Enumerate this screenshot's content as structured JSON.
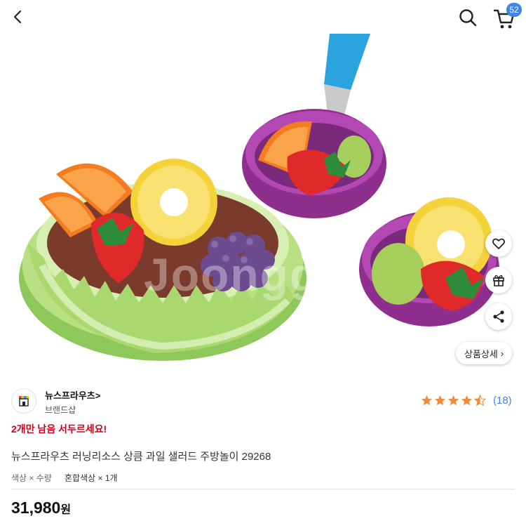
{
  "header": {
    "back_icon": "chevron-left-icon",
    "search_icon": "search-icon",
    "cart_icon": "cart-icon",
    "cart_count": "52",
    "badge_color": "#3e86e8"
  },
  "image": {
    "watermark": "Joonggo",
    "actions": {
      "like_icon": "heart-icon",
      "gift_icon": "gift-icon",
      "share_icon": "share-icon"
    },
    "detail_button": {
      "label": "상품상세",
      "arrow": "›"
    }
  },
  "product": {
    "brand_name": "뉴스프라우츠",
    "brand_arrow": ">",
    "brand_type": "브랜드샵",
    "rating": 4.5,
    "rating_color": "#f08a3c",
    "review_count": "(18)",
    "urgency": "2개만 남음 서두르세요!",
    "urgency_color": "#d0021b",
    "title": "뉴스프라우츠 러닝리소스 상큼 과일 샐러드 주방놀이 29268",
    "option_label": "색상 × 수량",
    "option_value": "혼합색상 × 1개",
    "price": "31,980",
    "price_unit": "원"
  }
}
